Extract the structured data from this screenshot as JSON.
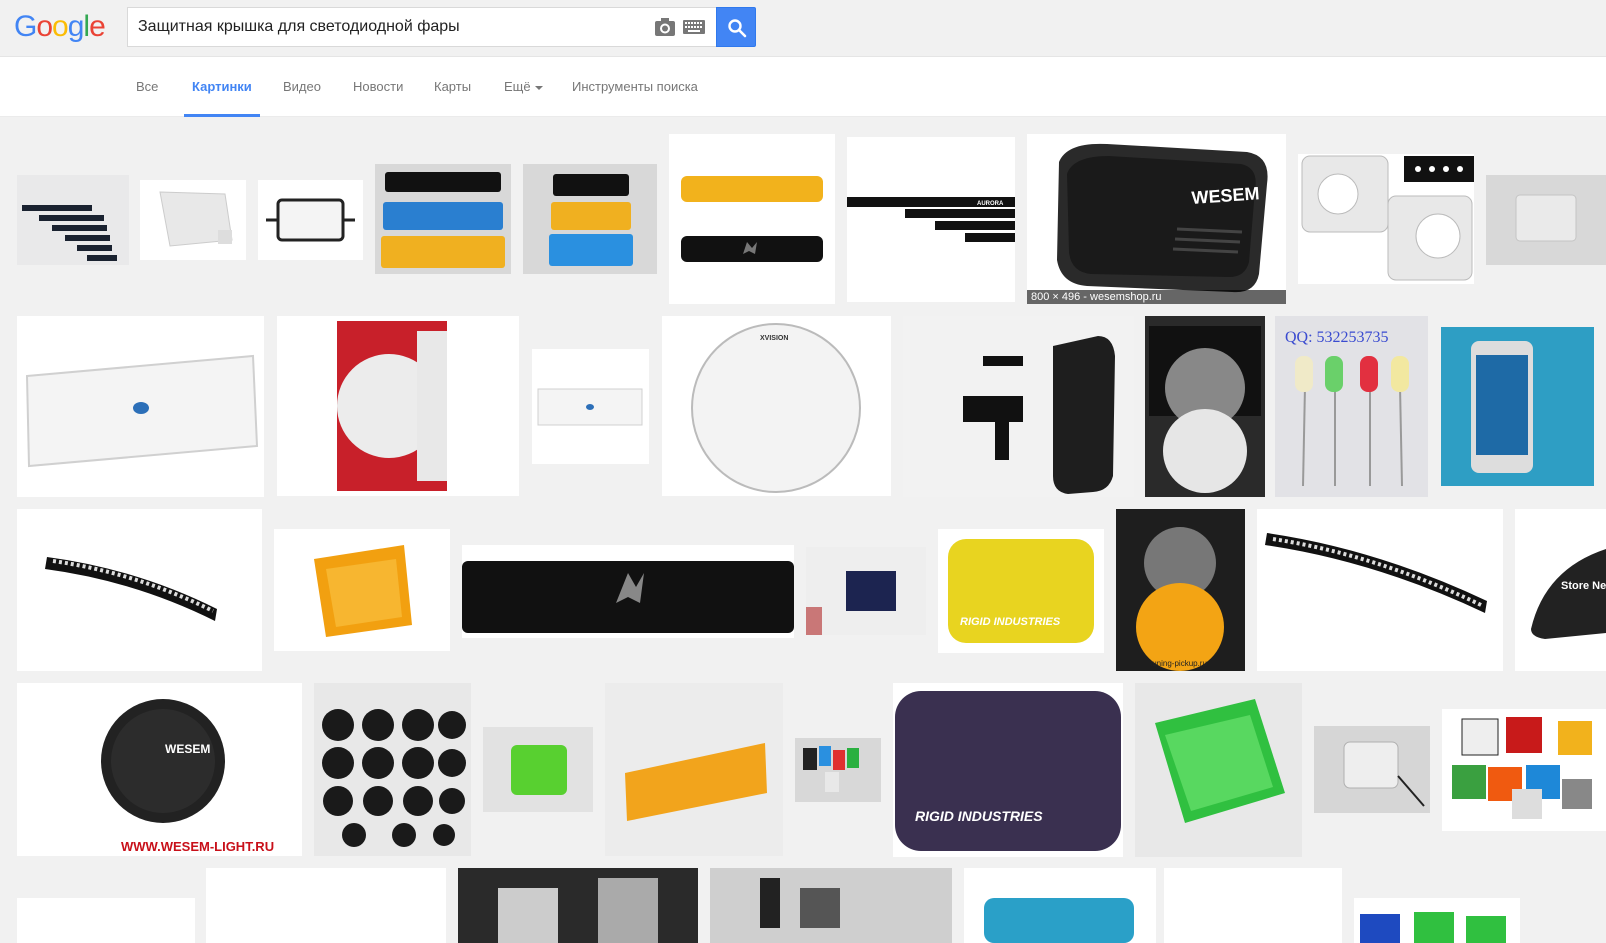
{
  "logo": {
    "text": "Google"
  },
  "search": {
    "query": "Защитная крышка для светодиодной фары"
  },
  "tabs": [
    {
      "label": "Все"
    },
    {
      "label": "Картинки"
    },
    {
      "label": "Видео"
    },
    {
      "label": "Новости"
    },
    {
      "label": "Карты"
    },
    {
      "label": "Ещё"
    },
    {
      "label": "Инструменты поиска"
    }
  ],
  "active_tab": "Картинки",
  "hover_caption": "800 × 496 - wesemshop.ru",
  "thumb_texts": {
    "wesem": "WESEM",
    "wesem_url": "WWW.WESEM-LIGHT.RU",
    "rigid": "RIGID INDUSTRIES",
    "xvision": "XVISION",
    "aurora": "AURORA",
    "qq": "QQ: 532253735",
    "store": "Store Ne",
    "tuning": "tuning-pickup.ru"
  },
  "colors": {
    "accent": "#4285f4",
    "bg": "#f1f1f1"
  }
}
